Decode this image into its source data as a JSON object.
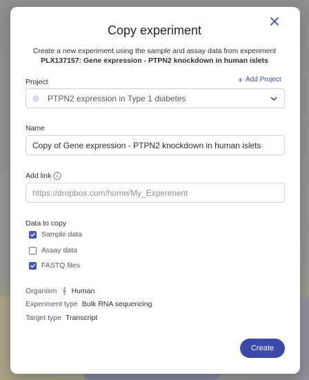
{
  "dialog": {
    "title": "Copy experiment",
    "subtitle_line1": "Create a new experiment using the sample and assay data from experiment",
    "subtitle_line2": "PLX137157: Gene expression - PTPN2 knockdown in human islets",
    "close_icon": "close-icon"
  },
  "project": {
    "label": "Project",
    "add_label": "Add Project",
    "selected": "PTPN2 expression in Type 1 diabetes",
    "dot_color": "#dcd6f4"
  },
  "name": {
    "label": "Name",
    "value": "Copy of Gene expression - PTPN2 knockdown in human islets"
  },
  "link": {
    "label": "Add link",
    "placeholder": "https://dropbox.com/home/My_Experiment"
  },
  "data_to_copy": {
    "label": "Data to copy",
    "options": [
      {
        "label": "Sample data",
        "checked": true
      },
      {
        "label": "Assay data",
        "checked": false
      },
      {
        "label": "FASTQ files",
        "checked": true
      }
    ]
  },
  "meta": {
    "organism_key": "Organism",
    "organism_value": "Human",
    "experiment_type_key": "Experiment type",
    "experiment_type_value": "Bulk RNA sequencing",
    "target_type_key": "Target type",
    "target_type_value": "Transcript"
  },
  "actions": {
    "create_label": "Create"
  },
  "colors": {
    "accent": "#3b4aa8",
    "checkbox_checked": "#4754b8"
  }
}
